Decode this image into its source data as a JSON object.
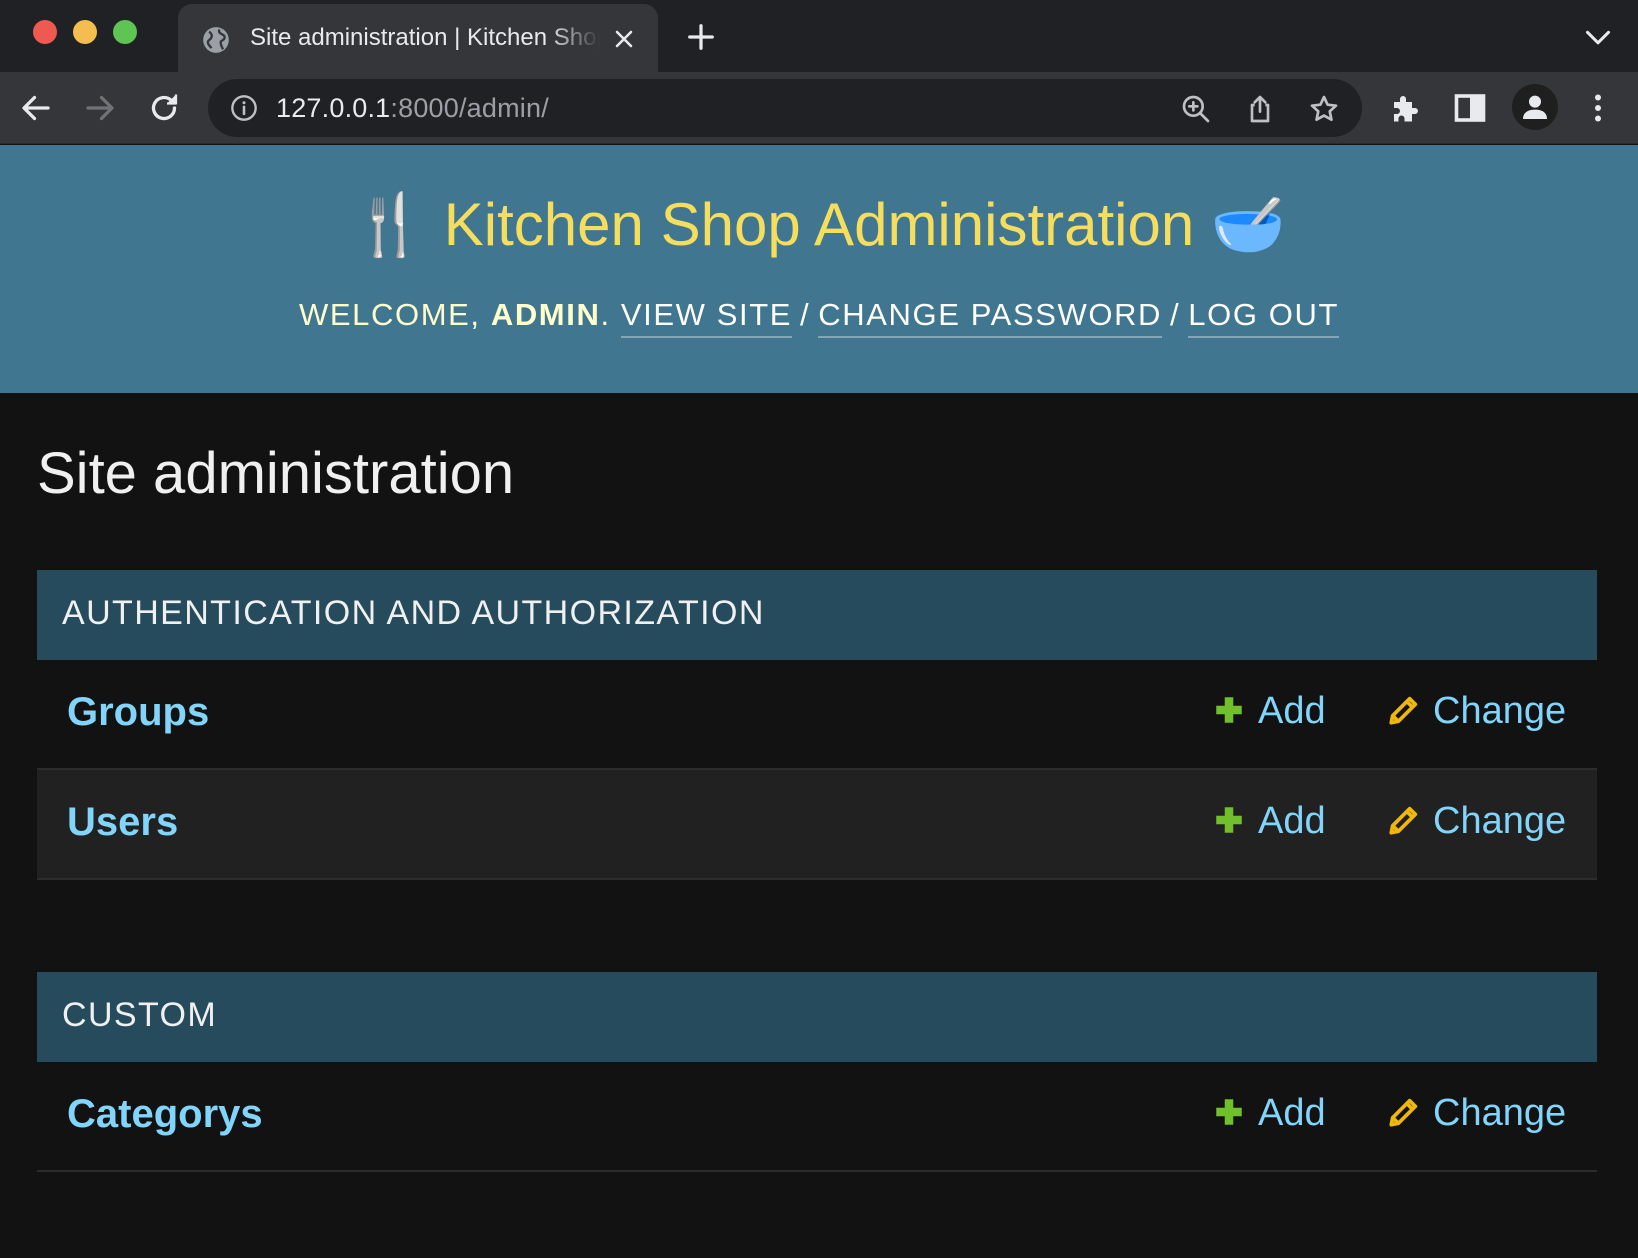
{
  "browser": {
    "tab_title": "Site administration | Kitchen Shop Administration",
    "url_host": "127.0.0.1",
    "url_path": ":8000/admin/"
  },
  "header": {
    "branding_icon_left": "🍴",
    "branding_title": "Kitchen Shop Administration",
    "branding_icon_right": "🥣",
    "welcome": "Welcome,",
    "username": "admin",
    "period": ".",
    "view_site": "View site",
    "change_password": "Change password",
    "log_out": "Log out",
    "separator": "/"
  },
  "content": {
    "title": "Site administration",
    "modules": [
      {
        "caption": "Authentication and Authorization",
        "models": [
          {
            "name": "Groups",
            "add": "Add",
            "change": "Change"
          },
          {
            "name": "Users",
            "add": "Add",
            "change": "Change"
          }
        ]
      },
      {
        "caption": "Custom",
        "models": [
          {
            "name": "Categorys",
            "add": "Add",
            "change": "Change"
          }
        ]
      }
    ]
  },
  "colors": {
    "header_bg": "#417690",
    "branding": "#f5dd5d",
    "module_caption_bg": "#264b5d",
    "link": "#81d4fa",
    "add_icon": "#70bf2b",
    "change_icon": "#efb80b"
  }
}
